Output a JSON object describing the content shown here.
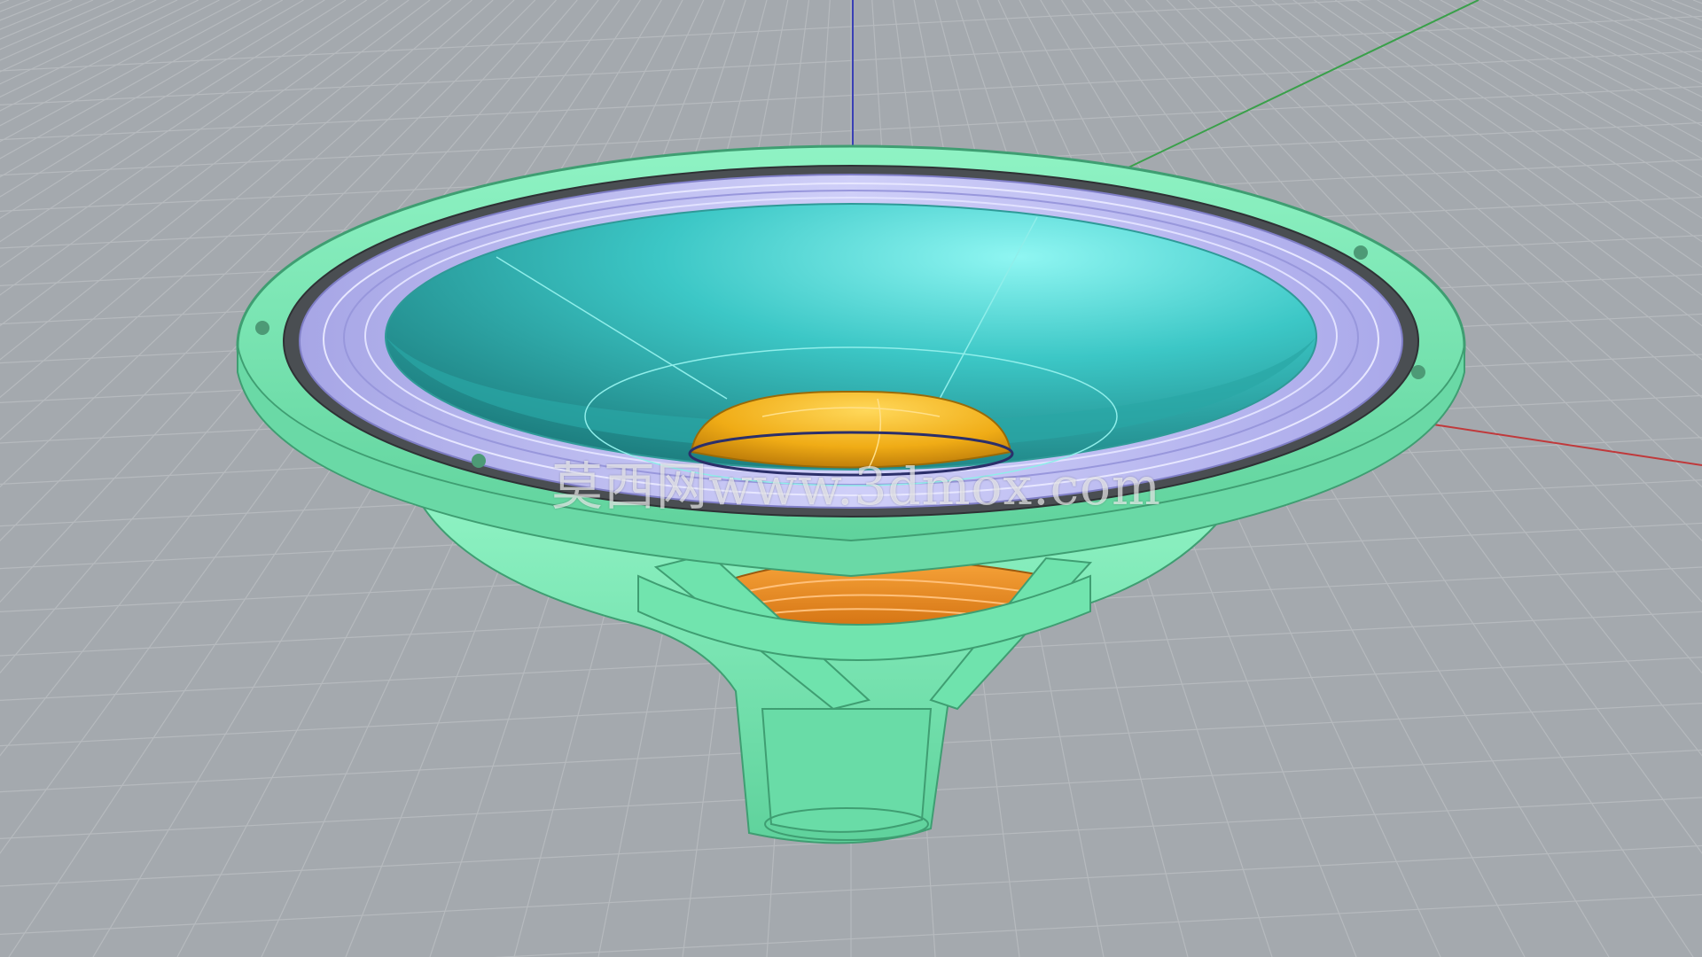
{
  "viewport": {
    "background": "#a4a9ae",
    "grid_color": "#b8bcc0",
    "axis_colors": {
      "x": "#c0393b",
      "y": "#3aa04a",
      "z": "#3a40b5"
    }
  },
  "model": {
    "name_icon": "loudspeaker-driver-model",
    "colors": {
      "frame": "#6fe3ad",
      "cone": "#3cc7c6",
      "surround": "#b9b8ef",
      "gasket": "#4a4e52",
      "dust_cap": "#f2b21a",
      "voice_coil": "#f08a1c"
    }
  },
  "watermark": {
    "text": "莫西网www.3dmox.com"
  }
}
